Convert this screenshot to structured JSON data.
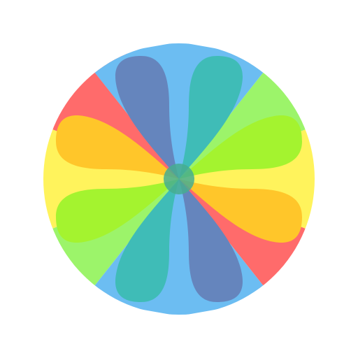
{
  "icon": {
    "name": "colorful-flower-petals-icon",
    "colors": {
      "background": "#ffffff",
      "red": "#ff6b6b",
      "green": "#9cf46a",
      "yellow": "#fff35c",
      "blue": "#6cbdf2",
      "orange": "#ffc62a",
      "lime": "#a4f32f",
      "navy": "#6585bd",
      "teal": "#3fbcb7",
      "center": "#47ad90"
    }
  }
}
